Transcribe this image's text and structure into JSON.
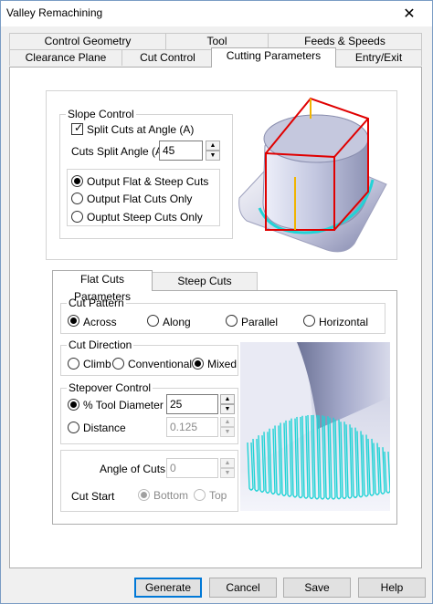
{
  "window": {
    "title": "Valley Remachining",
    "close_glyph": "✕"
  },
  "tabs_row1": [
    {
      "label": "Control Geometry"
    },
    {
      "label": "Tool"
    },
    {
      "label": "Feeds & Speeds"
    }
  ],
  "tabs_row2": [
    {
      "label": "Clearance Plane"
    },
    {
      "label": "Cut Control"
    },
    {
      "label": "Cutting Parameters",
      "active": true
    },
    {
      "label": "Entry/Exit"
    }
  ],
  "slope_control": {
    "group_label": "Slope Control",
    "split_cuts_label": "Split Cuts at Angle (A)",
    "split_cuts_checked": true,
    "angle_label": "Cuts Split Angle (A):",
    "angle_value": "45",
    "options": [
      {
        "label": "Output Flat & Steep Cuts",
        "selected": true
      },
      {
        "label": "Output Flat Cuts Only",
        "selected": false
      },
      {
        "label": "Ouptut Steep Cuts Only",
        "selected": false
      }
    ]
  },
  "subtabs": [
    {
      "label": "Flat Cuts Parameters",
      "active": true
    },
    {
      "label": "Steep Cuts Parameters",
      "active": false
    }
  ],
  "cut_pattern": {
    "group_label": "Cut Pattern",
    "options": [
      {
        "label": "Across",
        "selected": true
      },
      {
        "label": "Along",
        "selected": false
      },
      {
        "label": "Parallel",
        "selected": false
      },
      {
        "label": "Horizontal",
        "selected": false
      }
    ]
  },
  "cut_direction": {
    "group_label": "Cut Direction",
    "options": [
      {
        "label": "Climb",
        "selected": false
      },
      {
        "label": "Conventional",
        "selected": false
      },
      {
        "label": "Mixed",
        "selected": true
      }
    ]
  },
  "stepover": {
    "group_label": "Stepover Control",
    "tool_diameter_label": "% Tool Diameter",
    "tool_diameter_value": "25",
    "distance_label": "Distance",
    "distance_value": "0.125"
  },
  "angle_of_cuts": {
    "label": "Angle of Cuts:",
    "value": "0",
    "cut_start_label": "Cut Start",
    "bottom_label": "Bottom",
    "top_label": "Top"
  },
  "buttons": {
    "generate": "Generate",
    "cancel": "Cancel",
    "save": "Save",
    "help": "Help"
  },
  "colors": {
    "accent": "#0078d7",
    "toolpath": "#22d3d6",
    "boundary": "#e00000",
    "axis": "#f0b400",
    "part_shade": "#9aa0c0"
  }
}
